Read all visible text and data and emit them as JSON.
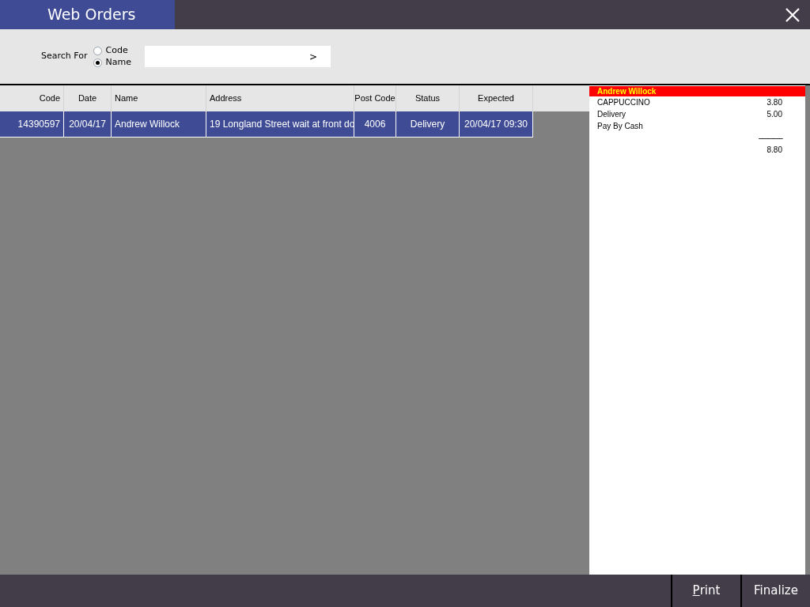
{
  "window": {
    "title": "Web Orders"
  },
  "search": {
    "label": "Search For",
    "options": [
      {
        "label": "Code",
        "selected": false
      },
      {
        "label": "Name",
        "selected": true
      }
    ],
    "go": ">"
  },
  "table": {
    "columns": [
      {
        "label": "Code"
      },
      {
        "label": "Date"
      },
      {
        "label": "Name"
      },
      {
        "label": "Address"
      },
      {
        "label": "Post Code"
      },
      {
        "label": "Status"
      },
      {
        "label": "Expected"
      }
    ],
    "rows": [
      {
        "selected": true,
        "cells": [
          "14390597",
          "20/04/17",
          "Andrew Willock",
          "19 Longland Street wait at front do",
          "4006",
          "Delivery",
          "20/04/17 09:30"
        ]
      }
    ]
  },
  "receipt": {
    "customer": "Andrew Willock",
    "lines": [
      {
        "kind": "item",
        "text": "CAPPUCCINO",
        "amount": "3.80"
      },
      {
        "kind": "item",
        "text": "Delivery",
        "amount": "5.00"
      },
      {
        "kind": "item",
        "text": "Pay By Cash"
      },
      {
        "kind": "rule",
        "amount": "-------------"
      },
      {
        "kind": "total",
        "amount": "8.80"
      }
    ]
  },
  "buttons": [
    {
      "label": "Print",
      "mnemonic_first": true
    },
    {
      "label": "Finalize",
      "mnemonic_first": false
    }
  ]
}
